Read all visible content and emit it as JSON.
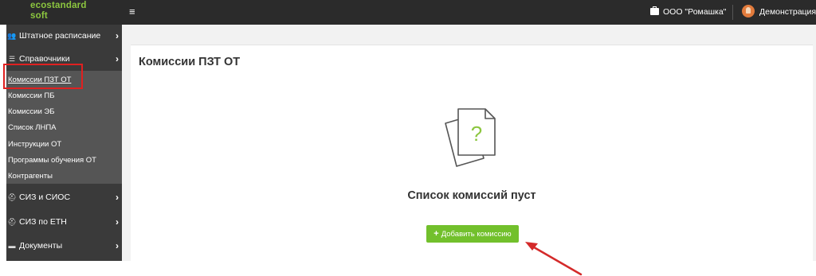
{
  "app": {
    "logo_line1": "ecostandard",
    "logo_line2": "soft",
    "menu_icon": "hamburger-icon",
    "brand_color": "#8cc63f"
  },
  "header": {
    "organization": "ООО \"Ромашка\"",
    "organization_icon": "briefcase-icon",
    "user_name": "Демонстрация",
    "user_icon": "avatar"
  },
  "sidebar": {
    "items": [
      {
        "label": "Штатное расписание",
        "icon": "users-icon"
      },
      {
        "label": "Справочники",
        "icon": "list-icon"
      },
      {
        "label": "СИЗ и СИОС",
        "icon": "helmet-icon"
      },
      {
        "label": "СИЗ по ЕТН",
        "icon": "helmet-icon"
      },
      {
        "label": "Документы",
        "icon": "folder-icon"
      }
    ],
    "submenu": [
      {
        "label": "Комиссии ПЗТ ОТ",
        "active": true
      },
      {
        "label": "Комиссии ПБ"
      },
      {
        "label": "Комиссии ЭБ"
      },
      {
        "label": "Список ЛНПА"
      },
      {
        "label": "Инструкции ОТ"
      },
      {
        "label": "Программы обучения ОТ"
      },
      {
        "label": "Контрагенты"
      }
    ]
  },
  "main": {
    "title": "Комиссии ПЗТ ОТ",
    "empty_icon": "document-question-icon",
    "empty_message": "Список комиссий пуст",
    "add_button_label": "Добавить комиссию",
    "accent_color": "#72c02c"
  },
  "annotations": {
    "highlight_color": "#e02020"
  }
}
